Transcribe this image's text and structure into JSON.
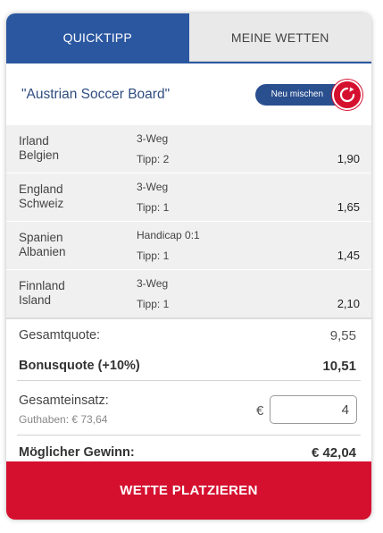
{
  "tabs": [
    {
      "label": "QUICKTIPP"
    },
    {
      "label": "MEINE WETTEN"
    }
  ],
  "title": "\"Austrian Soccer Board\"",
  "mix_label": "Neu mischen",
  "bets": [
    {
      "team_a": "Irland",
      "team_b": "Belgien",
      "market": "3-Weg",
      "tipp": "Tipp: 2",
      "odds": "1,90"
    },
    {
      "team_a": "England",
      "team_b": "Schweiz",
      "market": "3-Weg",
      "tipp": "Tipp: 1",
      "odds": "1,65"
    },
    {
      "team_a": "Spanien",
      "team_b": "Albanien",
      "market": "Handicap 0:1",
      "tipp": "Tipp: 1",
      "odds": "1,45"
    },
    {
      "team_a": "Finnland",
      "team_b": "Island",
      "market": "3-Weg",
      "tipp": "Tipp: 1",
      "odds": "2,10"
    }
  ],
  "summary": {
    "gesamtquote_label": "Gesamtquote:",
    "gesamtquote_value": "9,55",
    "bonusquote_label": "Bonusquote (+10%)",
    "bonusquote_value": "10,51",
    "einsatz_label": "Gesamteinsatz:",
    "guthaben": "Guthaben: € 73,64",
    "currency": "€",
    "einsatz_value": "4",
    "gewinn_label": "Möglicher Gewinn:",
    "gewinn_value": "€ 42,04"
  },
  "place_button": "WETTE PLATZIEREN",
  "colors": {
    "primary_blue": "#2a57a0",
    "accent_red": "#d5102f",
    "row_bg": "#f0f0f0"
  },
  "icons": {
    "mix": "refresh-icon"
  }
}
